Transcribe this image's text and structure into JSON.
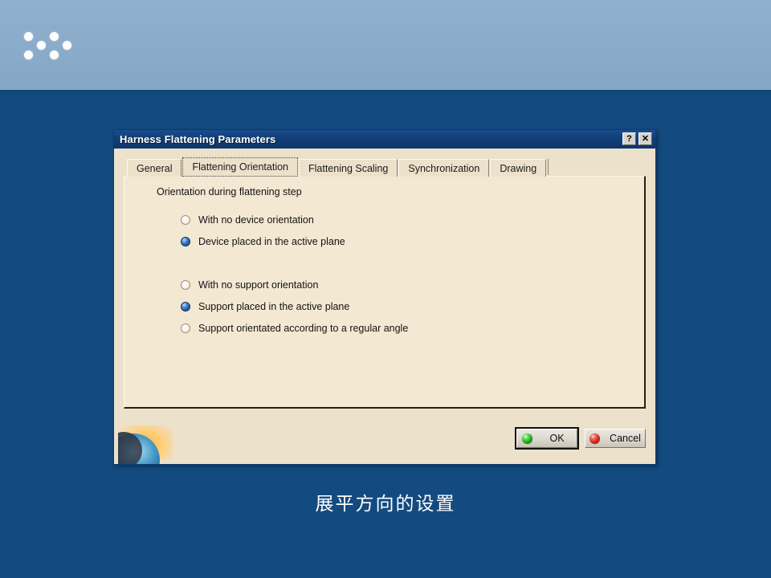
{
  "slide": {
    "background_color": "#134a80",
    "band_color": "#8aabc9",
    "caption": "展平方向的设置",
    "decoration_dots_count": 6
  },
  "dialog": {
    "title": "Harness Flattening Parameters",
    "titlebar_buttons": [
      {
        "name": "help",
        "glyph": "?"
      },
      {
        "name": "close",
        "glyph": "✕"
      }
    ],
    "tabs": [
      {
        "label": "General",
        "selected": false
      },
      {
        "label": "Flattening Orientation",
        "selected": true
      },
      {
        "label": "Flattening Scaling",
        "selected": false
      },
      {
        "label": "Synchronization",
        "selected": false
      },
      {
        "label": "Drawing",
        "selected": false
      }
    ],
    "panel": {
      "group_label": "Orientation during flattening step",
      "device_options": [
        {
          "label": "With no device orientation",
          "checked": false
        },
        {
          "label": "Device placed in the active plane",
          "checked": true
        }
      ],
      "support_options": [
        {
          "label": "With no support orientation",
          "checked": false
        },
        {
          "label": "Support placed in the active plane",
          "checked": true
        },
        {
          "label": "Support orientated according to a regular angle",
          "checked": false
        }
      ]
    },
    "buttons": [
      {
        "label": "OK",
        "icon": "green-sphere-icon",
        "default": true
      },
      {
        "label": "Cancel",
        "icon": "red-sphere-icon",
        "default": false
      }
    ]
  }
}
